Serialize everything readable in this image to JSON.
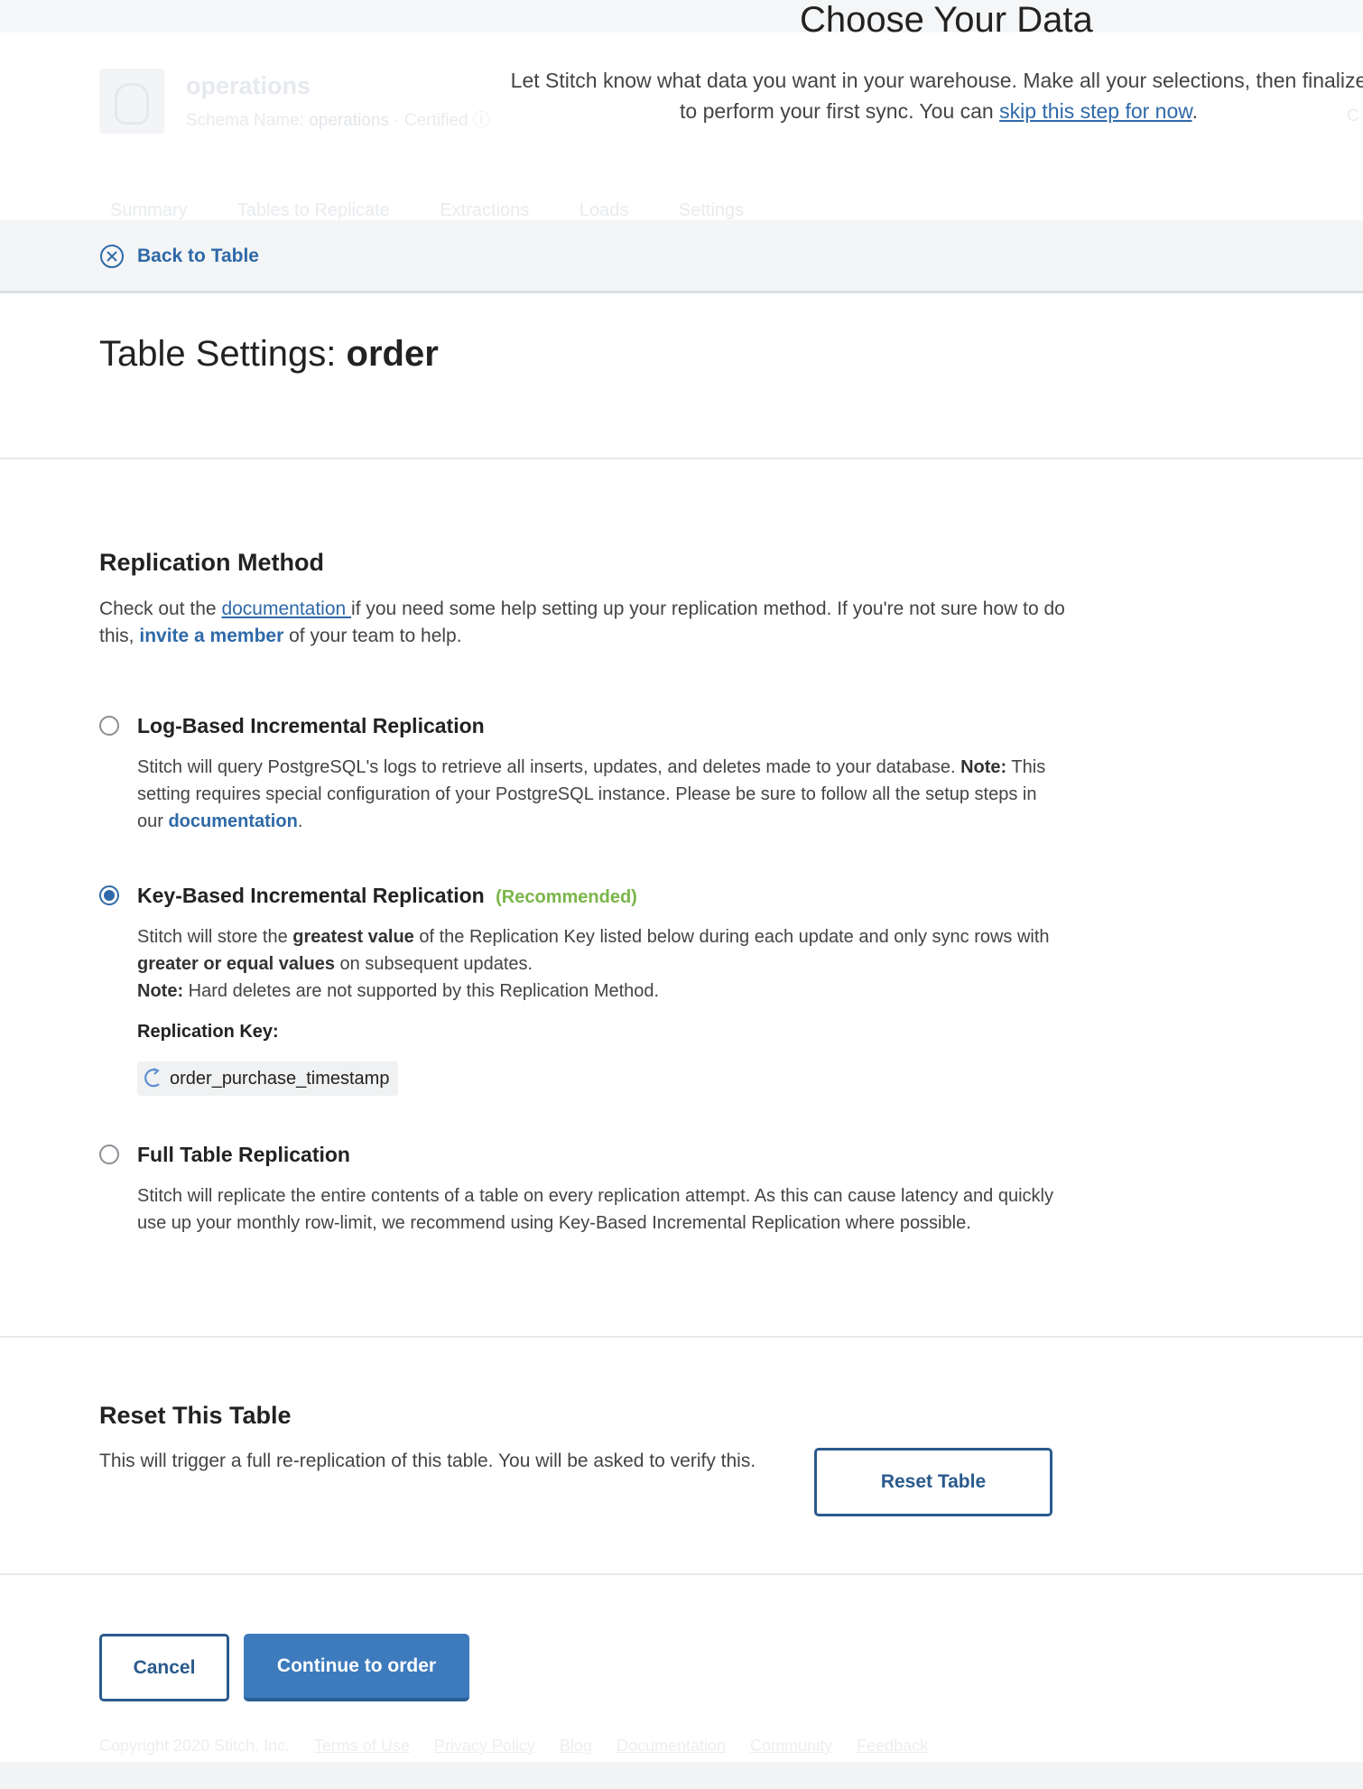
{
  "modal": {
    "title": "Choose Your Data",
    "desc_before": "Let Stitch know what data you want in your warehouse. Make all your selections, then finalize",
    "desc_after": "to perform your first sync. You can",
    "skip_link": "skip this step for now",
    "desc_end": "."
  },
  "background": {
    "source_title": "operations",
    "schema_label": "Schema Name:",
    "schema_value": "operations",
    "separator": "·",
    "certified": "Certified",
    "right_fragment": "C",
    "tabs": [
      "Summary",
      "Tables to Replicate",
      "Extractions",
      "Loads",
      "Settings"
    ],
    "footer": [
      "Copyright 2020 Stitch, Inc.",
      "Terms of Use",
      "Privacy Policy",
      "Blog",
      "Documentation",
      "Community",
      "Feedback"
    ]
  },
  "back": {
    "label": "Back to Table",
    "icon": "circle-x-icon"
  },
  "page": {
    "title_prefix": "Table Settings:",
    "table_name": "order"
  },
  "replication": {
    "heading": "Replication Method",
    "intro_1": "Check out the",
    "intro_link": "documentation ",
    "intro_2": "if you need some help setting up your replication method. If you're not sure how to do this,",
    "invite_link": "invite a member",
    "intro_3": "of your team to help.",
    "options": [
      {
        "title": "Log-Based Incremental Replication",
        "selected": false,
        "desc_1": "Stitch will query PostgreSQL's logs to retrieve all inserts, updates, and deletes made to your database.",
        "note_label": "Note:",
        "desc_2": "This setting requires special configuration of your PostgreSQL instance. Please be sure to follow all the setup steps in our",
        "link": "documentation",
        "desc_end": "."
      },
      {
        "title": "Key-Based Incremental Replication",
        "recommended": "(Recommended)",
        "selected": true,
        "desc_1": "Stitch will store the",
        "bold_1": "greatest value",
        "desc_2": "of the Replication Key listed below during each update and only sync rows with",
        "bold_2": "greater or equal values",
        "desc_3": "on subsequent updates.",
        "note_label": "Note:",
        "note_text": "Hard deletes are not supported by this Replication Method.",
        "key_label": "Replication Key:",
        "key_value": "order_purchase_timestamp",
        "key_icon": "refresh-icon"
      },
      {
        "title": "Full Table Replication",
        "selected": false,
        "desc": "Stitch will replicate the entire contents of a table on every replication attempt. As this can cause latency and quickly use up your monthly row-limit, we recommend using Key-Based Incremental Replication where possible."
      }
    ]
  },
  "reset": {
    "heading": "Reset This Table",
    "desc": "This will trigger a full re-replication of this table. You will be asked to verify this.",
    "button": "Reset Table"
  },
  "actions": {
    "cancel": "Cancel",
    "continue": "Continue to order"
  },
  "colors": {
    "accent": "#2e69a8",
    "primary_button": "#3d7bbd",
    "recommended": "#7ab648"
  }
}
